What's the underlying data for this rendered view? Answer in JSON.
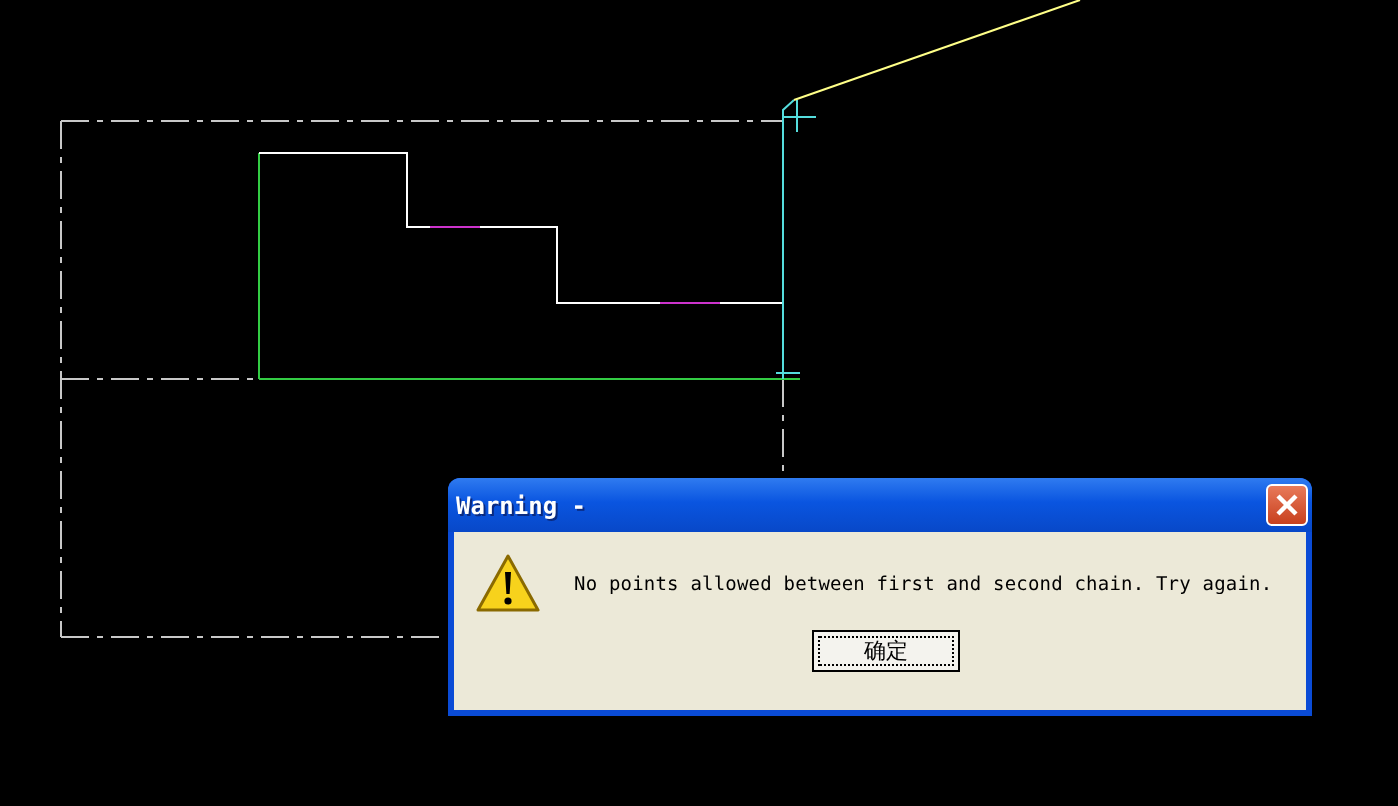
{
  "dialog": {
    "title": "Warning -",
    "message": "No points allowed between first and second chain. Try again.",
    "buttons": [
      {
        "label": "确定",
        "focused": true
      }
    ]
  }
}
